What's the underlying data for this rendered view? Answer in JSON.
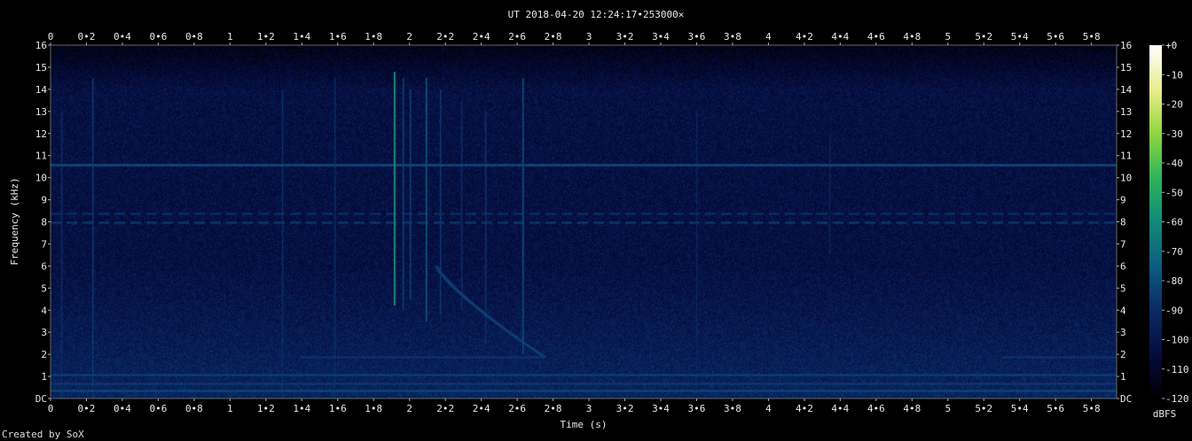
{
  "credit": "Created by SoX",
  "chart_data": {
    "type": "heatmap",
    "title": "UT 2018-04-20 12:24:17•253000×",
    "xlabel": "Time (s)",
    "ylabel": "Frequency (kHz)",
    "xlim": [
      0,
      5.94
    ],
    "ylim": [
      0,
      16
    ],
    "x_ticks": [
      "0",
      "0•2",
      "0•4",
      "0•6",
      "0•8",
      "1",
      "1•2",
      "1•4",
      "1•6",
      "1•8",
      "2",
      "2•2",
      "2•4",
      "2•6",
      "2•8",
      "3",
      "3•2",
      "3•4",
      "3•6",
      "3•8",
      "4",
      "4•2",
      "4•4",
      "4•6",
      "4•8",
      "5",
      "5•2",
      "5•4",
      "5•6",
      "5•8"
    ],
    "x_tick_values": [
      0,
      0.2,
      0.4,
      0.6,
      0.8,
      1,
      1.2,
      1.4,
      1.6,
      1.8,
      2,
      2.2,
      2.4,
      2.6,
      2.8,
      3,
      3.2,
      3.4,
      3.6,
      3.8,
      4,
      4.2,
      4.4,
      4.6,
      4.8,
      5,
      5.2,
      5.4,
      5.6,
      5.8
    ],
    "y_ticks": [
      "DC",
      "1",
      "2",
      "3",
      "4",
      "5",
      "6",
      "7",
      "8",
      "9",
      "10",
      "11",
      "12",
      "13",
      "14",
      "15",
      "16"
    ],
    "y_tick_values": [
      0,
      1,
      2,
      3,
      4,
      5,
      6,
      7,
      8,
      9,
      10,
      11,
      12,
      13,
      14,
      15,
      16
    ],
    "colorbar": {
      "label": "dBFS",
      "ticks": [
        "+0",
        "-10",
        "-20",
        "-30",
        "-40",
        "-50",
        "-60",
        "-70",
        "-80",
        "-90",
        "-100",
        "-110",
        "-120"
      ],
      "tick_values": [
        0,
        -10,
        -20,
        -30,
        -40,
        -50,
        -60,
        -70,
        -80,
        -90,
        -100,
        -110,
        -120
      ],
      "range": [
        -120,
        0
      ],
      "colors": [
        "#000000",
        "#050a3a",
        "#0a2a66",
        "#0e5a80",
        "#12897a",
        "#2cb35a",
        "#8fd640",
        "#e8ec8a",
        "#ffffff"
      ]
    },
    "background_level_dbfs": -102,
    "features": [
      {
        "kind": "tone",
        "freq_khz": 10.6,
        "dbfs": -78
      },
      {
        "kind": "tone_dashed",
        "freq_khz": 8.0,
        "dbfs": -85
      },
      {
        "kind": "tone_dashed",
        "freq_khz": 8.4,
        "dbfs": -88
      },
      {
        "kind": "tone",
        "freq_khz": 1.1,
        "dbfs": -82
      },
      {
        "kind": "tone",
        "freq_khz": 0.7,
        "dbfs": -84
      },
      {
        "kind": "tone",
        "freq_khz": 0.35,
        "dbfs": -80
      },
      {
        "kind": "tone_segment",
        "freq_khz": 1.9,
        "t0": 1.4,
        "t1": 2.75,
        "dbfs": -86
      },
      {
        "kind": "tone_segment",
        "freq_khz": 1.9,
        "t0": 5.3,
        "t1": 5.94,
        "dbfs": -86
      },
      {
        "kind": "sweep",
        "t0": 2.15,
        "f0": 6.0,
        "t1": 2.75,
        "f1": 1.9,
        "dbfs": -84
      },
      {
        "kind": "burst",
        "t": 0.23,
        "f0": 0,
        "f1": 14.5,
        "dbfs": -84
      },
      {
        "kind": "burst",
        "t": 0.06,
        "f0": 0,
        "f1": 13.0,
        "dbfs": -88
      },
      {
        "kind": "burst",
        "t": 1.29,
        "f0": 0,
        "f1": 14.0,
        "dbfs": -88
      },
      {
        "kind": "burst",
        "t": 1.58,
        "f0": 0,
        "f1": 14.5,
        "dbfs": -88
      },
      {
        "kind": "burst",
        "t": 1.91,
        "f0": 4.2,
        "f1": 14.8,
        "dbfs": -55
      },
      {
        "kind": "burst",
        "t": 1.96,
        "f0": 4.0,
        "f1": 14.5,
        "dbfs": -82
      },
      {
        "kind": "burst",
        "t": 2.0,
        "f0": 4.5,
        "f1": 14.0,
        "dbfs": -82
      },
      {
        "kind": "burst",
        "t": 2.09,
        "f0": 3.5,
        "f1": 14.5,
        "dbfs": -75
      },
      {
        "kind": "burst",
        "t": 2.17,
        "f0": 3.8,
        "f1": 14.0,
        "dbfs": -84
      },
      {
        "kind": "burst",
        "t": 2.29,
        "f0": 4.0,
        "f1": 13.5,
        "dbfs": -88
      },
      {
        "kind": "burst",
        "t": 2.42,
        "f0": 2.5,
        "f1": 13.0,
        "dbfs": -86
      },
      {
        "kind": "burst",
        "t": 2.63,
        "f0": 2.0,
        "f1": 14.5,
        "dbfs": -78
      },
      {
        "kind": "burst",
        "t": 3.6,
        "f0": 0,
        "f1": 13.0,
        "dbfs": -92
      },
      {
        "kind": "burst",
        "t": 4.34,
        "f0": 6.5,
        "f1": 12.0,
        "dbfs": -92
      }
    ]
  }
}
